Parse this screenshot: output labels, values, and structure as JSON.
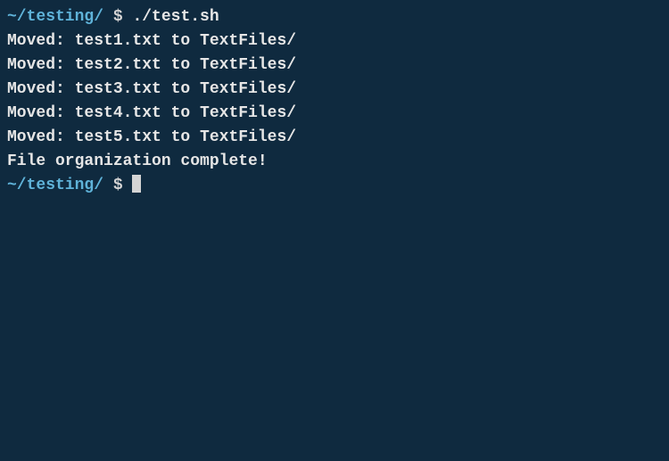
{
  "prompt1": {
    "path": "~/testing/",
    "symbol": " $ ",
    "command": "./test.sh"
  },
  "output": {
    "line1": "Moved: test1.txt to TextFiles/",
    "line2": "Moved: test2.txt to TextFiles/",
    "line3": "Moved: test3.txt to TextFiles/",
    "line4": "Moved: test4.txt to TextFiles/",
    "line5": "Moved: test5.txt to TextFiles/",
    "line6": "File organization complete!"
  },
  "prompt2": {
    "path": "~/testing/",
    "symbol": " $ "
  }
}
